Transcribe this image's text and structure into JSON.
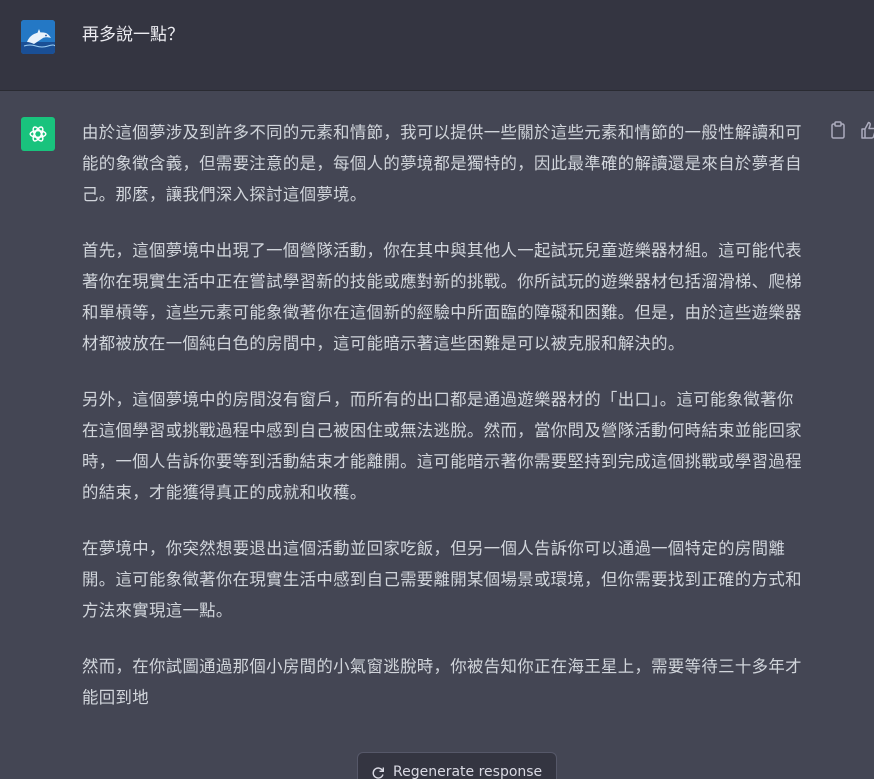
{
  "conversation": {
    "user_message": {
      "avatar_icon": "dolphin-avatar-icon",
      "text": "再多說一點？"
    },
    "assistant_message": {
      "avatar_icon": "openai-logo-icon",
      "avatar_color": "#19c37d",
      "paragraphs": [
        "由於這個夢涉及到許多不同的元素和情節，我可以提供一些關於這些元素和情節的一般性解讀和可能的象徵含義，但需要注意的是，每個人的夢境都是獨特的，因此最準確的解讀還是來自於夢者自己。那麼，讓我們深入探討這個夢境。",
        "首先，這個夢境中出現了一個營隊活動，你在其中與其他人一起試玩兒童遊樂器材組。這可能代表著你在現實生活中正在嘗試學習新的技能或應對新的挑戰。你所試玩的遊樂器材包括溜滑梯、爬梯和單槓等，這些元素可能象徵著你在這個新的經驗中所面臨的障礙和困難。但是，由於這些遊樂器材都被放在一個純白色的房間中，這可能暗示著這些困難是可以被克服和解決的。",
        "另外，這個夢境中的房間沒有窗戶，而所有的出口都是通過遊樂器材的「出口」。這可能象徵著你在這個學習或挑戰過程中感到自己被困住或無法逃脫。然而，當你問及營隊活動何時結束並能回家時，一個人告訴你要等到活動結束才能離開。這可能暗示著你需要堅持到完成這個挑戰或學習過程的結束，才能獲得真正的成就和收穫。",
        "在夢境中，你突然想要退出這個活動並回家吃飯，但另一個人告訴你可以通過一個特定的房間離開。這可能象徵著你在現實生活中感到自己需要離開某個場景或環境，但你需要找到正確的方式和方法來實現這一點。",
        "然而，在你試圖通過那個小房間的小氣窗逃脫時，你被告知你正在海王星上，需要等待三十多年才能回到地"
      ],
      "actions": [
        "copy-icon",
        "thumbs-up-icon"
      ]
    }
  },
  "regenerate_button": {
    "icon": "refresh-icon",
    "label": "Regenerate response"
  },
  "colors": {
    "user_background": "#343541",
    "assistant_background": "#444654",
    "text": "#d1d5db"
  }
}
